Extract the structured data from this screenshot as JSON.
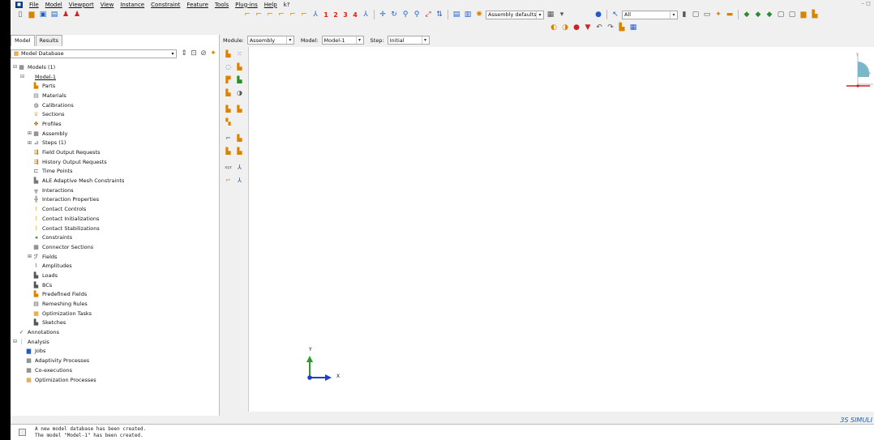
{
  "menubar": {
    "items": [
      "File",
      "Model",
      "Viewport",
      "View",
      "Instance",
      "Constraint",
      "Feature",
      "Tools",
      "Plug-ins",
      "Help"
    ],
    "help_extra": "k?"
  },
  "toolbar": {
    "numbers": [
      "1",
      "2",
      "3",
      "4"
    ],
    "assembly_combo": "Assembly defaults",
    "selection_combo": "All"
  },
  "tabs": {
    "model": "Model",
    "results": "Results"
  },
  "database": {
    "label": "Model Database"
  },
  "module_bar": {
    "module_label": "Module:",
    "module_value": "Assembly",
    "model_label": "Model:",
    "model_value": "Model-1",
    "step_label": "Step:",
    "step_value": "Initial"
  },
  "tree": [
    {
      "label": "Models (1)",
      "level": 0,
      "exp": "⊟",
      "icon": "▦",
      "color": "#555"
    },
    {
      "label": "Model-1",
      "level": 1,
      "exp": "⊟",
      "icon": "",
      "underline": true
    },
    {
      "label": "Parts",
      "level": 2,
      "icon": "▙",
      "color": "#d98400"
    },
    {
      "label": "Materials",
      "level": 2,
      "icon": "▤",
      "color": "#777"
    },
    {
      "label": "Calibrations",
      "level": 2,
      "icon": "◍",
      "color": "#555"
    },
    {
      "label": "Sections",
      "level": 2,
      "icon": "♕",
      "color": "#d98400"
    },
    {
      "label": "Profiles",
      "level": 2,
      "icon": "✥",
      "color": "#a05a00"
    },
    {
      "label": "Assembly",
      "level": 2,
      "exp": "⊞",
      "icon": "▦",
      "color": "#555"
    },
    {
      "label": "Steps (1)",
      "level": 2,
      "exp": "⊞",
      "icon": "⊿",
      "color": "#1f5cc9"
    },
    {
      "label": "Field Output Requests",
      "level": 2,
      "icon": "⇶",
      "color": "#a05a00"
    },
    {
      "label": "History Output Requests",
      "level": 2,
      "icon": "⇶",
      "color": "#a05a00"
    },
    {
      "label": "Time Points",
      "level": 2,
      "icon": "⊏",
      "color": "#555"
    },
    {
      "label": "ALE Adaptive Mesh Constraints",
      "level": 2,
      "icon": "▙",
      "color": "#777"
    },
    {
      "label": "Interactions",
      "level": 2,
      "icon": "╦",
      "color": "#555"
    },
    {
      "label": "Interaction Properties",
      "level": 2,
      "icon": "╬",
      "color": "#555"
    },
    {
      "label": "Contact Controls",
      "level": 2,
      "icon": "⁞",
      "color": "#d98400"
    },
    {
      "label": "Contact Initializations",
      "level": 2,
      "icon": "⁞",
      "color": "#d98400"
    },
    {
      "label": "Contact Stabilizations",
      "level": 2,
      "icon": "⁞",
      "color": "#d98400"
    },
    {
      "label": "Constraints",
      "level": 2,
      "icon": "◂",
      "color": "#2a8d2a"
    },
    {
      "label": "Connector Sections",
      "level": 2,
      "icon": "▦",
      "color": "#555"
    },
    {
      "label": "Fields",
      "level": 2,
      "exp": "⊞",
      "icon": "ℱ",
      "color": "#111"
    },
    {
      "label": "Amplitudes",
      "level": 2,
      "icon": "⌇",
      "color": "#555"
    },
    {
      "label": "Loads",
      "level": 2,
      "icon": "▙",
      "color": "#555"
    },
    {
      "label": "BCs",
      "level": 2,
      "icon": "▙",
      "color": "#555"
    },
    {
      "label": "Predefined Fields",
      "level": 2,
      "icon": "▙",
      "color": "#d98400"
    },
    {
      "label": "Remeshing Rules",
      "level": 2,
      "icon": "▤",
      "color": "#555"
    },
    {
      "label": "Optimization Tasks",
      "level": 2,
      "icon": "▦",
      "color": "#d98400"
    },
    {
      "label": "Sketches",
      "level": 2,
      "icon": "▙",
      "color": "#555"
    },
    {
      "label": "Annotations",
      "level": 0,
      "icon": "✓",
      "color": "#555"
    },
    {
      "label": "Analysis",
      "level": 0,
      "exp": "⊟",
      "icon": "⋮",
      "color": "#1f5cc9"
    },
    {
      "label": "Jobs",
      "level": 1,
      "icon": "▆",
      "color": "#1f5cc9"
    },
    {
      "label": "Adaptivity Processes",
      "level": 1,
      "icon": "▦",
      "color": "#555"
    },
    {
      "label": "Co-executions",
      "level": 1,
      "icon": "▦",
      "color": "#555"
    },
    {
      "label": "Optimization Processes",
      "level": 1,
      "icon": "▦",
      "color": "#d98400"
    }
  ],
  "triad": {
    "y": "Y",
    "x": "X"
  },
  "brand": "SIMULI",
  "messages": [
    "A new model database has been created.",
    "The model \"Model-1\" has been created."
  ]
}
